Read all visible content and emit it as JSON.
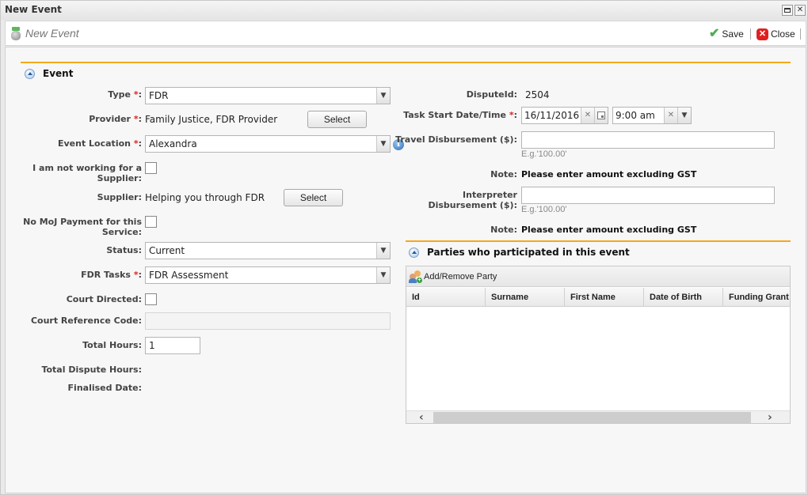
{
  "window": {
    "title": "New Event",
    "maximize_icon": "maximize-icon",
    "close_icon": "close-icon"
  },
  "toolbar": {
    "icon": "jar-icon",
    "title": "New Event",
    "save_label": "Save",
    "save_icon": "checkmark-icon",
    "close_label": "Close",
    "close_icon": "red-x-icon"
  },
  "event_section": {
    "title": "Event",
    "type": {
      "label": "Type",
      "value": "FDR"
    },
    "provider": {
      "label": "Provider",
      "value": "Family Justice, FDR Provider",
      "select_label": "Select"
    },
    "event_location": {
      "label": "Event Location",
      "value": "Alexandra"
    },
    "not_working_for_supplier": {
      "label": "I am not working for a Supplier:",
      "checked": false
    },
    "supplier": {
      "label": "Supplier:",
      "value": "Helping you through FDR",
      "select_label": "Select"
    },
    "no_moj_payment": {
      "label": "No MoJ Payment for this Service:",
      "checked": false
    },
    "status": {
      "label": "Status:",
      "value": "Current"
    },
    "fdr_tasks": {
      "label": "FDR Tasks",
      "value": "FDR Assessment"
    },
    "court_directed": {
      "label": "Court Directed:",
      "checked": false
    },
    "court_reference_code": {
      "label": "Court Reference Code:",
      "value": ""
    },
    "total_hours": {
      "label": "Total Hours:",
      "value": "1"
    },
    "total_dispute_hours": {
      "label": "Total Dispute Hours:",
      "value": ""
    },
    "finalised_date": {
      "label": "Finalised Date:",
      "value": ""
    },
    "required_marker": "*",
    "colon": ":"
  },
  "right_section": {
    "dispute_id": {
      "label": "DisputeId:",
      "value": "2504"
    },
    "task_start": {
      "label": "Task Start Date/Time",
      "date": "16/11/2016",
      "time": "9:00 am"
    },
    "travel_disbursement": {
      "label": "Travel Disbursement ($):",
      "value": "",
      "hint": "E.g.'100.00'"
    },
    "note1": {
      "label": "Note:",
      "value": "Please enter amount excluding GST"
    },
    "interpreter_disbursement": {
      "label_line1": "Interpreter",
      "label_line2": "Disbursement ($):",
      "value": "",
      "hint": "E.g.'100.00'"
    },
    "note2": {
      "label": "Note:",
      "value": "Please enter amount excluding GST"
    }
  },
  "parties_section": {
    "title": "Parties who participated in this event",
    "add_remove_label": "Add/Remove Party",
    "columns": [
      "Id",
      "Surname",
      "First Name",
      "Date of Birth",
      "Funding Grant"
    ],
    "rows": []
  },
  "colors": {
    "accent_line": "#f4a81c",
    "required": "#e02020",
    "save_check": "#4caf50",
    "close_red": "#e02020"
  }
}
